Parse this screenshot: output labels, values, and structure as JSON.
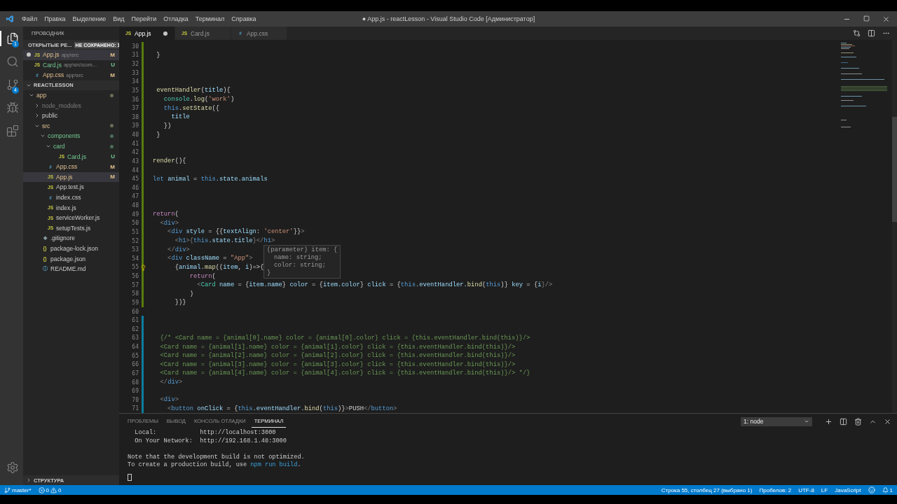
{
  "menu": [
    "Файл",
    "Правка",
    "Выделение",
    "Вид",
    "Перейти",
    "Отладка",
    "Терминал",
    "Справка"
  ],
  "window": {
    "title": "● App.js - reactLesson - Visual Studio Code [Администратор]"
  },
  "activity_bar": [
    {
      "kind": "files",
      "badge": "1",
      "selected": true
    },
    {
      "kind": "search",
      "selected": false
    },
    {
      "kind": "git",
      "badge": "4",
      "selected": false
    },
    {
      "kind": "debug",
      "selected": false
    },
    {
      "kind": "extensions",
      "selected": false
    }
  ],
  "sidebar": {
    "title": "ПРОВОДНИК",
    "open_editors": {
      "label": "ОТКРЫТЫЕ РЕ...",
      "badge": "НЕ СОХРАНЕНО: 1",
      "expanded": true,
      "items": [
        {
          "name": "App.js",
          "path": "app\\src",
          "kind": "js",
          "icon": "JS",
          "status": "M",
          "modified": true,
          "untracked": false,
          "dirty": true,
          "selected": true
        },
        {
          "name": "Card.js",
          "path": "app\\src\\com...",
          "kind": "js",
          "icon": "JS",
          "status": "U",
          "modified": false,
          "untracked": true,
          "dirty": false,
          "selected": false
        },
        {
          "name": "App.css",
          "path": "app\\src",
          "kind": "css",
          "icon": "#",
          "status": "M",
          "modified": true,
          "untracked": false,
          "dirty": false,
          "selected": false
        }
      ]
    },
    "project": {
      "label": "REACTLESSON",
      "expanded": true,
      "tree": [
        {
          "name": "app",
          "kind": "folder",
          "expanded": true,
          "modified": true,
          "untracked": false,
          "ignored": false,
          "selected": false,
          "children": [
            {
              "name": "node_modules",
              "kind": "folder",
              "expanded": false,
              "modified": false,
              "untracked": false,
              "ignored": true,
              "selected": false
            },
            {
              "name": "public",
              "kind": "folder",
              "expanded": false,
              "modified": false,
              "untracked": false,
              "ignored": false,
              "selected": false
            },
            {
              "name": "src",
              "kind": "folder",
              "expanded": true,
              "modified": true,
              "untracked": false,
              "ignored": false,
              "selected": false,
              "children": [
                {
                  "name": "components",
                  "kind": "folder",
                  "expanded": true,
                  "modified": false,
                  "untracked": true,
                  "ignored": false,
                  "selected": false,
                  "children": [
                    {
                      "name": "card",
                      "kind": "folder",
                      "expanded": true,
                      "modified": false,
                      "untracked": true,
                      "ignored": false,
                      "selected": false,
                      "children": [
                        {
                          "name": "Card.js",
                          "kind": "js",
                          "icon": "JS",
                          "status": "U",
                          "modified": false,
                          "untracked": true,
                          "ignored": false,
                          "selected": false
                        }
                      ]
                    }
                  ]
                },
                {
                  "name": "App.css",
                  "kind": "css",
                  "icon": "#",
                  "status": "M",
                  "modified": true,
                  "untracked": false,
                  "ignored": false,
                  "selected": false
                },
                {
                  "name": "App.js",
                  "kind": "js",
                  "icon": "JS",
                  "status": "M",
                  "modified": true,
                  "untracked": false,
                  "ignored": false,
                  "selected": true
                },
                {
                  "name": "App.test.js",
                  "kind": "js",
                  "icon": "JS",
                  "modified": false,
                  "untracked": false,
                  "ignored": false,
                  "selected": false
                },
                {
                  "name": "index.css",
                  "kind": "css",
                  "icon": "#",
                  "modified": false,
                  "untracked": false,
                  "ignored": false,
                  "selected": false
                },
                {
                  "name": "index.js",
                  "kind": "js",
                  "icon": "JS",
                  "modified": false,
                  "untracked": false,
                  "ignored": false,
                  "selected": false
                },
                {
                  "name": "serviceWorker.js",
                  "kind": "js",
                  "icon": "JS",
                  "modified": false,
                  "untracked": false,
                  "ignored": false,
                  "selected": false
                },
                {
                  "name": "setupTests.js",
                  "kind": "js",
                  "icon": "JS",
                  "modified": false,
                  "untracked": false,
                  "ignored": false,
                  "selected": false
                }
              ]
            },
            {
              "name": ".gitignore",
              "kind": "git",
              "icon": "◆",
              "modified": false,
              "untracked": false,
              "ignored": false,
              "selected": false
            },
            {
              "name": "package-lock.json",
              "kind": "json",
              "icon": "{}",
              "modified": false,
              "untracked": false,
              "ignored": false,
              "selected": false
            },
            {
              "name": "package.json",
              "kind": "json",
              "icon": "{}",
              "modified": false,
              "untracked": false,
              "ignored": false,
              "selected": false
            },
            {
              "name": "README.md",
              "kind": "md",
              "icon": "ⓘ",
              "modified": false,
              "untracked": false,
              "ignored": false,
              "selected": false
            }
          ]
        }
      ]
    },
    "outline": {
      "label": "СТРУКТУРА",
      "expanded": false
    }
  },
  "tabs": [
    {
      "label": "App.js",
      "kind": "js",
      "icon": "JS",
      "dirty": true,
      "selected": true
    },
    {
      "label": "Card.js",
      "kind": "js",
      "icon": "JS",
      "dirty": false,
      "selected": false
    },
    {
      "label": "App.css",
      "kind": "css",
      "icon": "#",
      "dirty": false,
      "selected": false
    }
  ],
  "editor": {
    "lines": [
      {
        "n": "30",
        "kind": "added"
      },
      {
        "n": "31",
        "kind": "added",
        "tokens": [
          {
            "text": " }",
            "kind": "punct"
          }
        ]
      },
      {
        "n": "32",
        "kind": "added"
      },
      {
        "n": "33",
        "kind": "added"
      },
      {
        "n": "34",
        "kind": "added"
      },
      {
        "n": "35",
        "kind": "added",
        "tokens": [
          {
            "text": " eventHandler",
            "kind": "fn"
          },
          {
            "text": "(",
            "kind": "punct"
          },
          {
            "text": "title",
            "kind": "var"
          },
          {
            "text": "){",
            "kind": "punct"
          }
        ]
      },
      {
        "n": "36",
        "kind": "added",
        "tokens": [
          {
            "text": "   console",
            "kind": "cls"
          },
          {
            "text": ".",
            "kind": "punct"
          },
          {
            "text": "log",
            "kind": "fn"
          },
          {
            "text": "(",
            "kind": "punct"
          },
          {
            "text": "'work'",
            "kind": "str"
          },
          {
            "text": ")",
            "kind": "punct"
          }
        ]
      },
      {
        "n": "37",
        "kind": "added",
        "tokens": [
          {
            "text": "   this",
            "kind": "kw"
          },
          {
            "text": ".",
            "kind": "punct"
          },
          {
            "text": "setState",
            "kind": "fn"
          },
          {
            "text": "({",
            "kind": "punct"
          }
        ]
      },
      {
        "n": "38",
        "kind": "added",
        "tokens": [
          {
            "text": "     title",
            "kind": "var"
          }
        ]
      },
      {
        "n": "39",
        "kind": "added",
        "tokens": [
          {
            "text": "   })",
            "kind": "punct"
          }
        ]
      },
      {
        "n": "40",
        "kind": "added",
        "tokens": [
          {
            "text": " }",
            "kind": "punct"
          }
        ]
      },
      {
        "n": "41",
        "kind": "added"
      },
      {
        "n": "42",
        "kind": "added"
      },
      {
        "n": "43",
        "kind": "added",
        "tokens": [
          {
            "text": "render",
            "kind": "fn"
          },
          {
            "text": "(){",
            "kind": "punct"
          }
        ]
      },
      {
        "n": "44",
        "kind": "added"
      },
      {
        "n": "45",
        "kind": "added",
        "tokens": [
          {
            "text": "let ",
            "kind": "kw"
          },
          {
            "text": "animal",
            "kind": "var"
          },
          {
            "text": " = ",
            "kind": "punct"
          },
          {
            "text": "this",
            "kind": "kw"
          },
          {
            "text": ".state.animals",
            "kind": "var"
          }
        ]
      },
      {
        "n": "46",
        "kind": "added"
      },
      {
        "n": "47",
        "kind": "added"
      },
      {
        "n": "48",
        "kind": "added"
      },
      {
        "n": "49",
        "kind": "added",
        "tokens": [
          {
            "text": "return",
            "kind": "ctl"
          },
          {
            "text": "(",
            "kind": "punct"
          }
        ]
      },
      {
        "n": "50",
        "kind": "added",
        "tokens": [
          {
            "text": "  <",
            "kind": "br"
          },
          {
            "text": "div",
            "kind": "kw"
          },
          {
            "text": ">",
            "kind": "br"
          }
        ]
      },
      {
        "n": "51",
        "kind": "added",
        "tokens": [
          {
            "text": "    <",
            "kind": "br"
          },
          {
            "text": "div",
            "kind": "kw"
          },
          {
            "text": " style",
            "kind": "var"
          },
          {
            "text": " = {{",
            "kind": "punct"
          },
          {
            "text": "textAlign",
            "kind": "var"
          },
          {
            "text": ": ",
            "kind": "punct"
          },
          {
            "text": "'center'",
            "kind": "str"
          },
          {
            "text": "}}",
            "kind": "punct"
          },
          {
            "text": ">",
            "kind": "br"
          }
        ]
      },
      {
        "n": "52",
        "kind": "added",
        "tokens": [
          {
            "text": "      <",
            "kind": "br"
          },
          {
            "text": "h1",
            "kind": "kw"
          },
          {
            "text": ">{",
            "kind": "br"
          },
          {
            "text": "this",
            "kind": "kw"
          },
          {
            "text": ".state.title",
            "kind": "var"
          },
          {
            "text": "}</",
            "kind": "br"
          },
          {
            "text": "h1",
            "kind": "kw"
          },
          {
            "text": ">",
            "kind": "br"
          }
        ]
      },
      {
        "n": "53",
        "kind": "added",
        "tokens": [
          {
            "text": "    </",
            "kind": "br"
          },
          {
            "text": "div",
            "kind": "kw"
          },
          {
            "text": ">",
            "kind": "br"
          }
        ]
      },
      {
        "n": "54",
        "kind": "added",
        "tokens": [
          {
            "text": "    <",
            "kind": "br"
          },
          {
            "text": "div",
            "kind": "kw"
          },
          {
            "text": " className",
            "kind": "var"
          },
          {
            "text": " = ",
            "kind": "punct"
          },
          {
            "text": "\"App\"",
            "kind": "str"
          },
          {
            "text": ">",
            "kind": "br"
          }
        ]
      },
      {
        "n": "55",
        "kind": "added",
        "lightbulb": true,
        "tokens": [
          {
            "text": "      {",
            "kind": "punct"
          },
          {
            "text": "animal",
            "kind": "var"
          },
          {
            "text": ".",
            "kind": "punct"
          },
          {
            "text": "map",
            "kind": "fn"
          },
          {
            "text": "((",
            "kind": "punct"
          },
          {
            "text": "item",
            "kind": "var"
          },
          {
            "text": ", ",
            "kind": "punct"
          },
          {
            "text": "i",
            "kind": "var"
          },
          {
            "text": ")=>{",
            "kind": "punct"
          }
        ]
      },
      {
        "n": "56",
        "kind": "added",
        "tokens": [
          {
            "text": "          return",
            "kind": "ctl"
          },
          {
            "text": "(",
            "kind": "punct"
          }
        ]
      },
      {
        "n": "57",
        "kind": "added",
        "tokens": [
          {
            "text": "            <",
            "kind": "br"
          },
          {
            "text": "Card",
            "kind": "cls"
          },
          {
            "text": " name",
            "kind": "var"
          },
          {
            "text": " = {",
            "kind": "punct"
          },
          {
            "text": "item.name",
            "kind": "var"
          },
          {
            "text": "} ",
            "kind": "punct"
          },
          {
            "text": "color",
            "kind": "var"
          },
          {
            "text": " = {",
            "kind": "punct"
          },
          {
            "text": "item.color",
            "kind": "var"
          },
          {
            "text": "} ",
            "kind": "punct"
          },
          {
            "text": "click",
            "kind": "var"
          },
          {
            "text": " = {",
            "kind": "punct"
          },
          {
            "text": "this",
            "kind": "kw"
          },
          {
            "text": ".eventHandler.",
            "kind": "var"
          },
          {
            "text": "bind",
            "kind": "fn"
          },
          {
            "text": "(",
            "kind": "punct"
          },
          {
            "text": "this",
            "kind": "kw"
          },
          {
            "text": ")} ",
            "kind": "punct"
          },
          {
            "text": "key",
            "kind": "var"
          },
          {
            "text": " = {",
            "kind": "punct"
          },
          {
            "text": "i",
            "kind": "var"
          },
          {
            "text": "}/>",
            "kind": "br"
          }
        ]
      },
      {
        "n": "58",
        "kind": "added",
        "tokens": [
          {
            "text": "          )",
            "kind": "punct"
          }
        ]
      },
      {
        "n": "59",
        "kind": "added",
        "tokens": [
          {
            "text": "      })}",
            "kind": "punct"
          }
        ]
      },
      {
        "n": "60",
        "kind": "unchanged"
      },
      {
        "n": "61",
        "kind": "modified"
      },
      {
        "n": "62",
        "kind": "modified"
      },
      {
        "n": "63",
        "kind": "modified",
        "tokens": [
          {
            "text": "  {/* <Card name = {animal[0].name} color = {animal[0].color} click = {this.eventHandler.bind(this)}/>",
            "kind": "comment"
          }
        ]
      },
      {
        "n": "64",
        "kind": "modified",
        "tokens": [
          {
            "text": "  <Card name = {animal[1].name} color = {animal[1].color} click = {this.eventHandler.bind(this)}/>",
            "kind": "comment"
          }
        ]
      },
      {
        "n": "65",
        "kind": "modified",
        "tokens": [
          {
            "text": "  <Card name = {animal[2].name} color = {animal[2].color} click = {this.eventHandler.bind(this)}/>",
            "kind": "comment"
          }
        ]
      },
      {
        "n": "66",
        "kind": "modified",
        "tokens": [
          {
            "text": "  <Card name = {animal[3].name} color = {animal[3].color} click = {this.eventHandler.bind(this)}/>",
            "kind": "comment"
          }
        ]
      },
      {
        "n": "67",
        "kind": "modified",
        "tokens": [
          {
            "text": "  <Card name = {animal[4].name} color = {animal[4].color} click = {this.eventHandler.bind(this)}/> */}",
            "kind": "comment"
          }
        ]
      },
      {
        "n": "68",
        "kind": "modified",
        "tokens": [
          {
            "text": "  </",
            "kind": "br"
          },
          {
            "text": "div",
            "kind": "kw"
          },
          {
            "text": ">",
            "kind": "br"
          }
        ]
      },
      {
        "n": "69",
        "kind": "modified"
      },
      {
        "n": "70",
        "kind": "modified",
        "tokens": [
          {
            "text": "  <",
            "kind": "br"
          },
          {
            "text": "div",
            "kind": "kw"
          },
          {
            "text": ">",
            "kind": "br"
          }
        ]
      },
      {
        "n": "71",
        "kind": "modified",
        "tokens": [
          {
            "text": "    <",
            "kind": "br"
          },
          {
            "text": "button",
            "kind": "kw"
          },
          {
            "text": " onClick",
            "kind": "var"
          },
          {
            "text": " = {",
            "kind": "punct"
          },
          {
            "text": "this",
            "kind": "kw"
          },
          {
            "text": ".eventHandler.",
            "kind": "var"
          },
          {
            "text": "bind",
            "kind": "fn"
          },
          {
            "text": "(",
            "kind": "punct"
          },
          {
            "text": "this",
            "kind": "kw"
          },
          {
            "text": ")}",
            "kind": "punct"
          },
          {
            "text": ">",
            "kind": "br"
          },
          {
            "text": "PUSH",
            "kind": "punct"
          },
          {
            "text": "</",
            "kind": "br"
          },
          {
            "text": "button",
            "kind": "kw"
          },
          {
            "text": ">",
            "kind": "br"
          }
        ]
      }
    ],
    "hover": {
      "lines": [
        "(parameter) item: {",
        "name: string;",
        "color: string;",
        "}"
      ]
    }
  },
  "panel": {
    "tabs": [
      {
        "label": "ПРОБЛЕМЫ",
        "selected": false
      },
      {
        "label": "ВЫВОД",
        "selected": false
      },
      {
        "label": "КОНСОЛЬ ОТЛАДКИ",
        "selected": false
      },
      {
        "label": "ТЕРМИНАЛ",
        "selected": true
      }
    ],
    "terminal_select": "1: node",
    "terminal": [
      [
        {
          "text": "  Local:            http://localhost:3000",
          "kind": "out"
        }
      ],
      [
        {
          "text": "  On Your Network:  http://192.168.1.48:3000",
          "kind": "out"
        }
      ],
      [
        {
          "text": "Note that the development build is not optimized.",
          "kind": "out",
          "gap": true
        }
      ],
      [
        {
          "text": "To create a production build, use ",
          "kind": "out"
        },
        {
          "text": "npm run build",
          "kind": "cmd"
        },
        {
          "text": ".",
          "kind": "out"
        }
      ]
    ]
  },
  "status_bar": {
    "branch": "master*",
    "errors": "0",
    "warnings": "0",
    "position": "Строка 55, столбец 27 (выбрано 1)",
    "spaces": "Пробелов: 2",
    "encoding": "UTF-8",
    "eol": "LF",
    "language": "JavaScript",
    "notifications": "1"
  }
}
